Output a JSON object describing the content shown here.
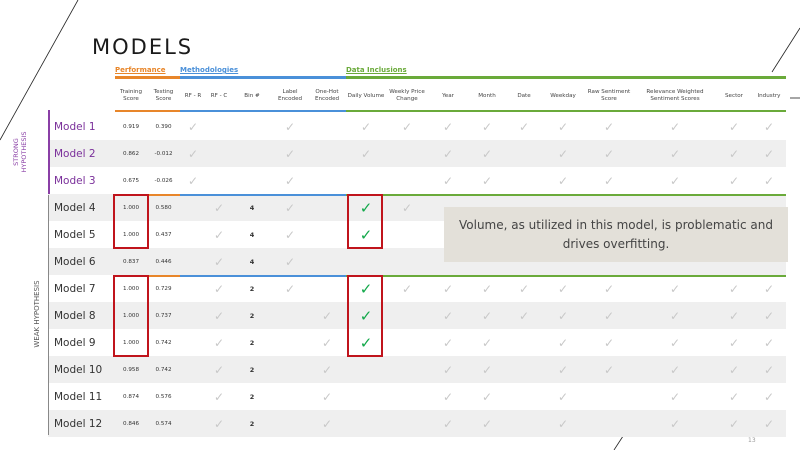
{
  "title": "MODELS",
  "groups": [
    {
      "label": "Performance",
      "color": "#e8862a"
    },
    {
      "label": "Methodologies",
      "color": "#4a90d9"
    },
    {
      "label": "Data Inclusions",
      "color": "#6aaa3a"
    }
  ],
  "columns": [
    "Training Score",
    "Testing Score",
    "RF - R",
    "RF - C",
    "Bin #",
    "Label Encoded",
    "One-Hot Encoded",
    "Daily Volume",
    "Weekly Price Change",
    "Year",
    "Month",
    "Date",
    "Weekday",
    "Raw Sentiment Score",
    "Relevance Weighted Sentiment Scores",
    "Sector",
    "Industry"
  ],
  "hypotheses": {
    "strong": "STRONG HYPOTHESIS",
    "weak": "WEAK HYPOTHESIS"
  },
  "rows": [
    {
      "model": "Model 1",
      "training": "0.919",
      "testing": "0.390",
      "bin": "",
      "checks": {
        "rfr": true,
        "rfc": false,
        "label": true,
        "onehot": false,
        "volume": true,
        "weekly": true,
        "year": true,
        "month": true,
        "date": true,
        "weekday": true,
        "raw": true,
        "rel": true,
        "sector": true,
        "industry": true
      }
    },
    {
      "model": "Model 2",
      "training": "0.862",
      "testing": "-0.012",
      "bin": "",
      "checks": {
        "rfr": true,
        "rfc": false,
        "label": true,
        "onehot": false,
        "volume": true,
        "weekly": false,
        "year": true,
        "month": true,
        "date": false,
        "weekday": true,
        "raw": true,
        "rel": true,
        "sector": true,
        "industry": true
      }
    },
    {
      "model": "Model 3",
      "training": "0.675",
      "testing": "-0.026",
      "bin": "",
      "checks": {
        "rfr": true,
        "rfc": false,
        "label": true,
        "onehot": false,
        "volume": false,
        "weekly": false,
        "year": true,
        "month": true,
        "date": false,
        "weekday": true,
        "raw": true,
        "rel": true,
        "sector": true,
        "industry": true
      }
    },
    {
      "model": "Model 4",
      "training": "1.000",
      "testing": "0.580",
      "bin": "4",
      "checks": {
        "rfr": false,
        "rfc": true,
        "label": true,
        "onehot": false,
        "volume": true,
        "weekly": true,
        "year": false,
        "month": false,
        "date": false,
        "weekday": false,
        "raw": false,
        "rel": false,
        "sector": false,
        "industry": false
      }
    },
    {
      "model": "Model 5",
      "training": "1.000",
      "testing": "0.437",
      "bin": "4",
      "checks": {
        "rfr": false,
        "rfc": true,
        "label": true,
        "onehot": false,
        "volume": true,
        "weekly": false,
        "year": false,
        "month": false,
        "date": false,
        "weekday": false,
        "raw": false,
        "rel": false,
        "sector": false,
        "industry": false
      }
    },
    {
      "model": "Model 6",
      "training": "0.837",
      "testing": "0.446",
      "bin": "4",
      "checks": {
        "rfr": false,
        "rfc": true,
        "label": true,
        "onehot": false,
        "volume": false,
        "weekly": false,
        "year": false,
        "month": false,
        "date": false,
        "weekday": false,
        "raw": false,
        "rel": false,
        "sector": false,
        "industry": false
      }
    },
    {
      "model": "Model 7",
      "training": "1.000",
      "testing": "0.729",
      "bin": "2",
      "checks": {
        "rfr": false,
        "rfc": true,
        "label": true,
        "onehot": false,
        "volume": true,
        "weekly": true,
        "year": true,
        "month": true,
        "date": true,
        "weekday": true,
        "raw": true,
        "rel": true,
        "sector": true,
        "industry": true
      }
    },
    {
      "model": "Model 8",
      "training": "1.000",
      "testing": "0.737",
      "bin": "2",
      "checks": {
        "rfr": false,
        "rfc": true,
        "label": false,
        "onehot": true,
        "volume": true,
        "weekly": false,
        "year": true,
        "month": true,
        "date": true,
        "weekday": true,
        "raw": true,
        "rel": true,
        "sector": true,
        "industry": true
      }
    },
    {
      "model": "Model 9",
      "training": "1.000",
      "testing": "0.742",
      "bin": "2",
      "checks": {
        "rfr": false,
        "rfc": true,
        "label": false,
        "onehot": true,
        "volume": true,
        "weekly": false,
        "year": true,
        "month": true,
        "date": false,
        "weekday": true,
        "raw": true,
        "rel": true,
        "sector": true,
        "industry": true
      }
    },
    {
      "model": "Model 10",
      "training": "0.958",
      "testing": "0.742",
      "bin": "2",
      "checks": {
        "rfr": false,
        "rfc": true,
        "label": false,
        "onehot": true,
        "volume": false,
        "weekly": false,
        "year": true,
        "month": true,
        "date": false,
        "weekday": true,
        "raw": true,
        "rel": true,
        "sector": true,
        "industry": true
      }
    },
    {
      "model": "Model 11",
      "training": "0.874",
      "testing": "0.576",
      "bin": "2",
      "checks": {
        "rfr": false,
        "rfc": true,
        "label": false,
        "onehot": true,
        "volume": false,
        "weekly": false,
        "year": true,
        "month": true,
        "date": false,
        "weekday": true,
        "raw": false,
        "rel": true,
        "sector": true,
        "industry": true
      }
    },
    {
      "model": "Model 12",
      "training": "0.846",
      "testing": "0.574",
      "bin": "2",
      "checks": {
        "rfr": false,
        "rfc": true,
        "label": false,
        "onehot": true,
        "volume": false,
        "weekly": false,
        "year": true,
        "month": true,
        "date": false,
        "weekday": true,
        "raw": false,
        "rel": true,
        "sector": true,
        "industry": true
      }
    }
  ],
  "highlighted_checks": {
    "volume_rows": [
      "Model 4",
      "Model 5",
      "Model 7",
      "Model 8",
      "Model 9"
    ]
  },
  "callout": "Volume, as utilized in this model, is problematic and drives overfitting.",
  "page_number": "13",
  "colors": {
    "purple": "#8a3fa6",
    "highlight_red": "#c0141c",
    "check_green": "#12a84a",
    "check_gray": "#c8c8c8",
    "callout_bg": "#e3e0d9"
  }
}
